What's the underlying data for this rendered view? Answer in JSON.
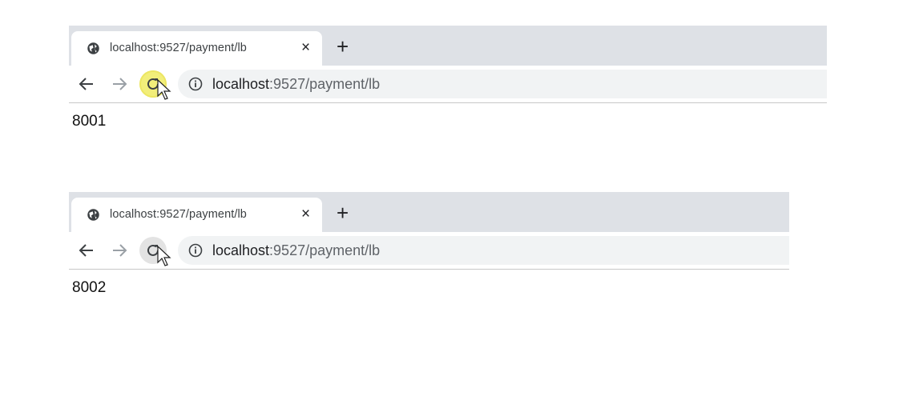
{
  "windows": [
    {
      "tab": {
        "title": "localhost:9527/payment/lb",
        "close": "×"
      },
      "new_tab": "+",
      "address": {
        "host": "localhost",
        "path": ":9527/payment/lb"
      },
      "page_text": "8001"
    },
    {
      "tab": {
        "title": "localhost:9527/payment/lb",
        "close": "×"
      },
      "new_tab": "+",
      "address": {
        "host": "localhost",
        "path": ":9527/payment/lb"
      },
      "page_text": "8002"
    }
  ],
  "colors": {
    "tabstrip": "#dee1e6",
    "omnibox": "#f1f3f4",
    "click_highlight": "#f2ee7a"
  }
}
